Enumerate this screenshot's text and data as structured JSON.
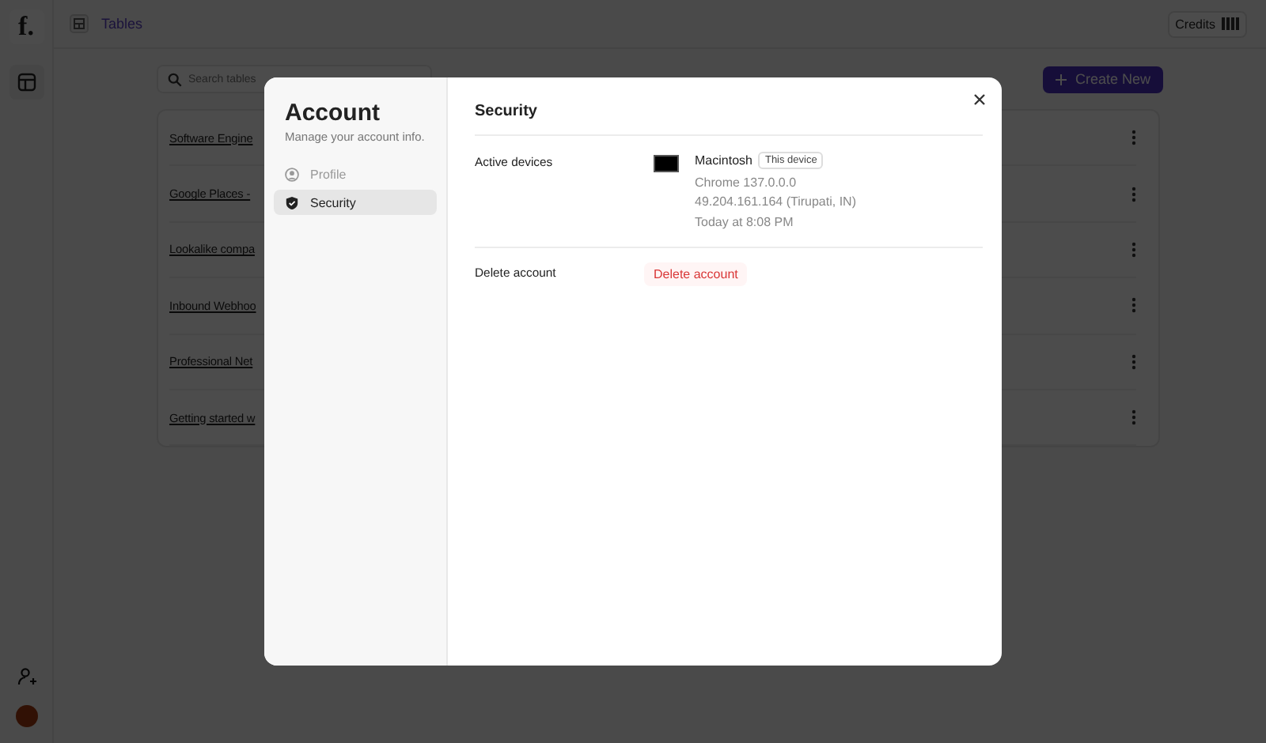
{
  "topbar": {
    "logo": "f.",
    "breadcrumb": "Tables",
    "credits": "Credits"
  },
  "search": {
    "placeholder": "Search tables"
  },
  "create_button": "Create New",
  "tables": [
    {
      "name": "Software Engine"
    },
    {
      "name": "Google Places -"
    },
    {
      "name": "Lookalike compa"
    },
    {
      "name": "Inbound Webhoo"
    },
    {
      "name": "Professional Net"
    },
    {
      "name": "Getting started w"
    }
  ],
  "modal": {
    "title": "Account",
    "subtitle": "Manage your account info.",
    "nav": [
      {
        "label": "Profile",
        "selected": false
      },
      {
        "label": "Security",
        "selected": true
      }
    ],
    "section_title": "Security",
    "active_devices": {
      "label": "Active devices",
      "devices": [
        {
          "name": "Macintosh",
          "badge": "This device",
          "browser": "Chrome 137.0.0.0",
          "ip": "49.204.161.164 (Tirupati, IN)",
          "time": "Today at 8:08 PM"
        }
      ]
    },
    "delete": {
      "label": "Delete account",
      "button": "Delete account"
    }
  }
}
